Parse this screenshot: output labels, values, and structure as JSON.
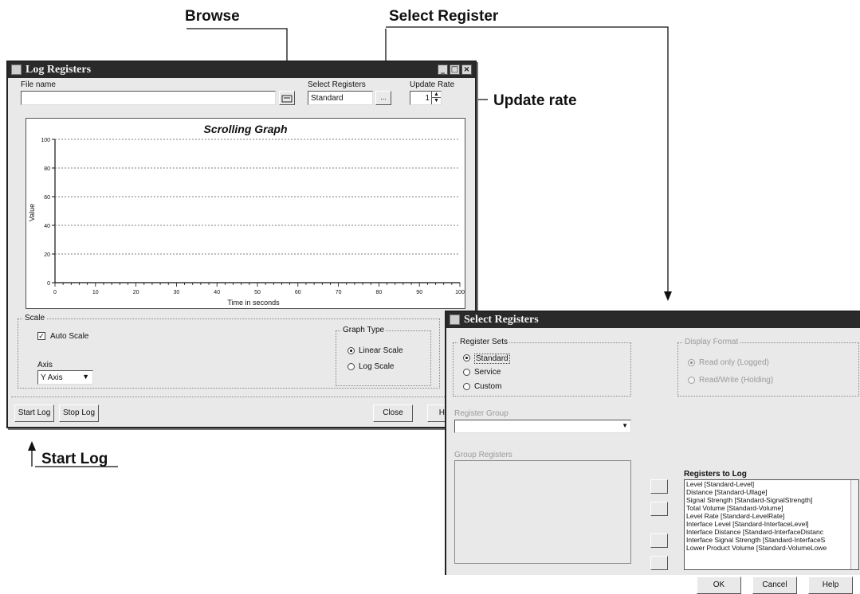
{
  "callouts": {
    "browse": "Browse",
    "select_register": "Select Register",
    "update_rate": "Update rate",
    "start_log": "Start Log"
  },
  "log_window": {
    "title": "Log Registers",
    "file_name_label": "File name",
    "file_name_value": "",
    "select_registers_label": "Select Registers",
    "select_registers_value": "Standard",
    "update_rate_label": "Update Rate",
    "update_rate_value": "1",
    "graph": {
      "title": "Scrolling Graph",
      "ylabel": "Value",
      "xlabel": "Time in seconds",
      "yticks": [
        "0",
        "20",
        "40",
        "60",
        "80",
        "100"
      ],
      "xticks": [
        "0",
        "10",
        "20",
        "30",
        "40",
        "50",
        "60",
        "70",
        "80",
        "90",
        "100"
      ]
    },
    "scale_group": "Scale",
    "auto_scale_label": "Auto Scale",
    "auto_scale_checked": true,
    "axis_label": "Axis",
    "axis_value": "Y Axis",
    "graph_type_group": "Graph Type",
    "linear_scale_label": "Linear Scale",
    "log_scale_label": "Log Scale",
    "graph_type_selected": "linear",
    "start_log_button": "Start Log",
    "stop_log_button": "Stop Log",
    "close_button": "Close",
    "help_button": "Help"
  },
  "select_window": {
    "title": "Select Registers",
    "register_sets_group": "Register Sets",
    "standard_label": "Standard",
    "service_label": "Service",
    "custom_label": "Custom",
    "display_format_group": "Display Format",
    "read_only_label": "Read only (Logged)",
    "read_write_label": "Read/Write (Holding)",
    "register_group_label": "Register Group",
    "group_registers_label": "Group Registers",
    "registers_to_log_label": "Registers to Log",
    "registers_to_log": [
      "Level [Standard-Level]",
      "Distance [Standard-Ullage]",
      "Signal Strength [Standard-SignalStrength]",
      "Total Volume [Standard-Volume]",
      "Level Rate [Standard-LevelRate]",
      "Interface Level [Standard-InterfaceLevel]",
      "Interface Distance [Standard-InterfaceDistanc",
      "Interface Signal Strength [Standard-InterfaceS",
      "Lower Product Volume [Standard-VolumeLowe"
    ],
    "ok_button": "OK",
    "cancel_button": "Cancel",
    "help_button": "Help"
  }
}
